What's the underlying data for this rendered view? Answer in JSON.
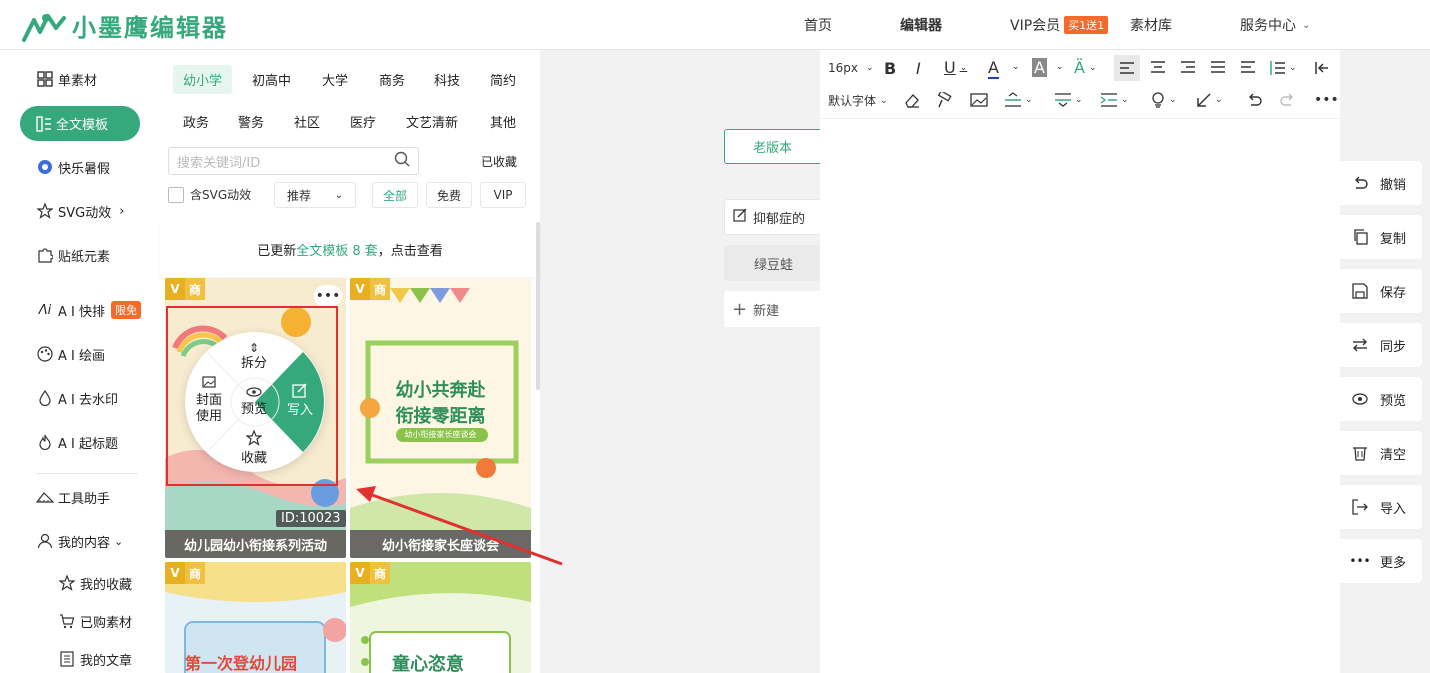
{
  "header": {
    "logo_text": "小墨鹰编辑器",
    "nav": [
      "首页",
      "编辑器",
      "VIP会员",
      "素材库",
      "服务中心"
    ],
    "vip_badge": "买1送1",
    "service_chevron": "chevron-down"
  },
  "leftnav": {
    "items": [
      {
        "label": "单素材",
        "icon": "grid-icon"
      },
      {
        "label": "全文模板",
        "icon": "template-icon"
      },
      {
        "label": "快乐暑假",
        "icon": "ball-icon"
      },
      {
        "label": "SVG动效",
        "icon": "star-icon"
      },
      {
        "label": "贴纸元素",
        "icon": "puzzle-icon"
      },
      {
        "label": "A I 快排",
        "icon": "ai-icon"
      },
      {
        "label": "A I 绘画",
        "icon": "palette-icon"
      },
      {
        "label": "A I 去水印",
        "icon": "drop-icon"
      },
      {
        "label": "A I 起标题",
        "icon": "fire-icon"
      },
      {
        "label": "工具助手",
        "icon": "ruler-icon"
      },
      {
        "label": "我的内容",
        "icon": "user-icon"
      },
      {
        "label": "我的收藏",
        "icon": "star-icon"
      },
      {
        "label": "已购素材",
        "icon": "cart-icon"
      },
      {
        "label": "我的文章",
        "icon": "doc-icon"
      }
    ],
    "limit_badge": "限免"
  },
  "panel": {
    "categories_row1": [
      "幼小学",
      "初高中",
      "大学",
      "商务",
      "科技",
      "简约"
    ],
    "categories_row2": [
      "政务",
      "警务",
      "社区",
      "医疗",
      "文艺清新",
      "其他"
    ],
    "search_placeholder": "搜索关键词/ID",
    "collected_label": "已收藏",
    "svg_checkbox_label": "含SVG动效",
    "sort_label": "推荐",
    "filters": [
      "全部",
      "免费",
      "VIP"
    ],
    "notice_prefix": "已更新",
    "notice_highlight": "全文模板 8 套",
    "notice_suffix": "，点击查看",
    "cards": [
      {
        "title": "幼儿园幼小衔接系列活动",
        "id": "ID:10023",
        "badge_v": "V",
        "badge_s": "商"
      },
      {
        "title": "幼小衔接家长座谈会",
        "badge_v": "V",
        "badge_s": "商",
        "poster_line1": "幼小共奔赴",
        "poster_line2": "衔接零距离",
        "poster_sub": "幼小衔接家长座谈会"
      },
      {
        "title": "",
        "badge_v": "V",
        "badge_s": "商",
        "poster_line1": "第一次登幼儿园"
      },
      {
        "title": "",
        "badge_v": "V",
        "badge_s": "商",
        "poster_line1": "童心恣意"
      }
    ],
    "radial_menu": {
      "split": "拆分",
      "cover": "封面使用",
      "preview": "预览",
      "write": "写入",
      "collect": "收藏"
    }
  },
  "docs": {
    "old_version": "老版本",
    "tabs": [
      "抑郁症的",
      "绿豆蛙"
    ],
    "new_label": "新建"
  },
  "toolbar": {
    "font_size": "16px",
    "font_family": "默认字体"
  },
  "rightbar": {
    "items": [
      {
        "label": "撤销",
        "icon": "undo-icon"
      },
      {
        "label": "复制",
        "icon": "copy-icon"
      },
      {
        "label": "保存",
        "icon": "save-icon"
      },
      {
        "label": "同步",
        "icon": "sync-icon"
      },
      {
        "label": "预览",
        "icon": "eye-icon"
      },
      {
        "label": "清空",
        "icon": "trash-icon"
      },
      {
        "label": "导入",
        "icon": "import-icon"
      },
      {
        "label": "更多",
        "icon": "more-icon"
      }
    ]
  },
  "colors": {
    "brand": "#35a87c",
    "badge": "#f56a2a",
    "highlight_box": "#e03030"
  }
}
